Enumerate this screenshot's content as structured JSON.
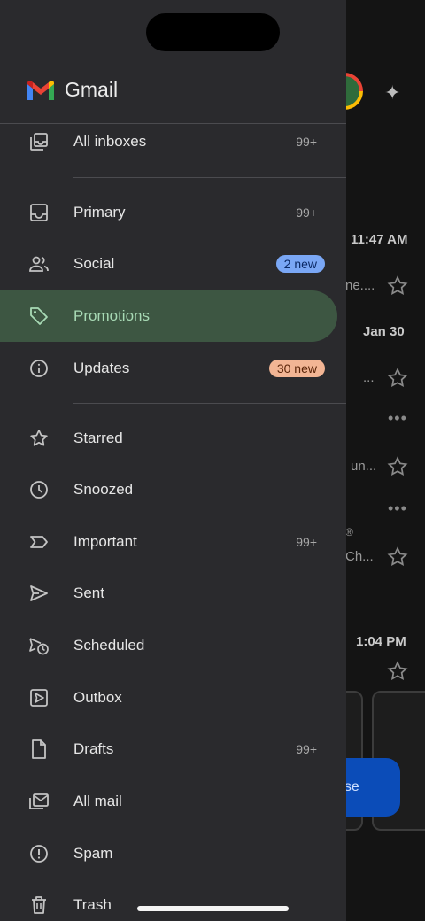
{
  "app": {
    "title": "Gmail"
  },
  "colors": {
    "drawer_bg": "#2a2a2d",
    "active_bg": "#3d5642",
    "active_text": "#a8dab5",
    "social_badge_bg": "#7aa7f5",
    "updates_badge_bg": "#f2b594",
    "compose_bg": "#0b4cb8"
  },
  "drawer": {
    "top": [
      {
        "label": "All inboxes",
        "count": "99+",
        "icon": "all-inboxes-icon"
      }
    ],
    "inbox": [
      {
        "label": "Primary",
        "count": "99+",
        "icon": "inbox-icon"
      },
      {
        "label": "Social",
        "badge": "2 new",
        "icon": "people-icon"
      },
      {
        "label": "Promotions",
        "icon": "tag-icon",
        "active": true
      },
      {
        "label": "Updates",
        "badge": "30 new",
        "icon": "info-icon"
      }
    ],
    "folders": [
      {
        "label": "Starred",
        "icon": "star-icon"
      },
      {
        "label": "Snoozed",
        "icon": "clock-icon"
      },
      {
        "label": "Important",
        "count": "99+",
        "icon": "important-icon"
      },
      {
        "label": "Sent",
        "icon": "send-icon"
      },
      {
        "label": "Scheduled",
        "icon": "scheduled-send-icon"
      },
      {
        "label": "Outbox",
        "icon": "outbox-icon"
      },
      {
        "label": "Drafts",
        "count": "99+",
        "icon": "draft-icon"
      },
      {
        "label": "All mail",
        "icon": "all-mail-icon"
      },
      {
        "label": "Spam",
        "icon": "spam-icon"
      },
      {
        "label": "Trash",
        "icon": "trash-icon"
      }
    ]
  },
  "background_inbox": {
    "times": [
      "11:47 AM",
      "Jan 30",
      "1:04 PM"
    ],
    "snippets": [
      "ne....",
      "...",
      "un...",
      "®",
      "Ch..."
    ],
    "compose_label": "ose"
  }
}
